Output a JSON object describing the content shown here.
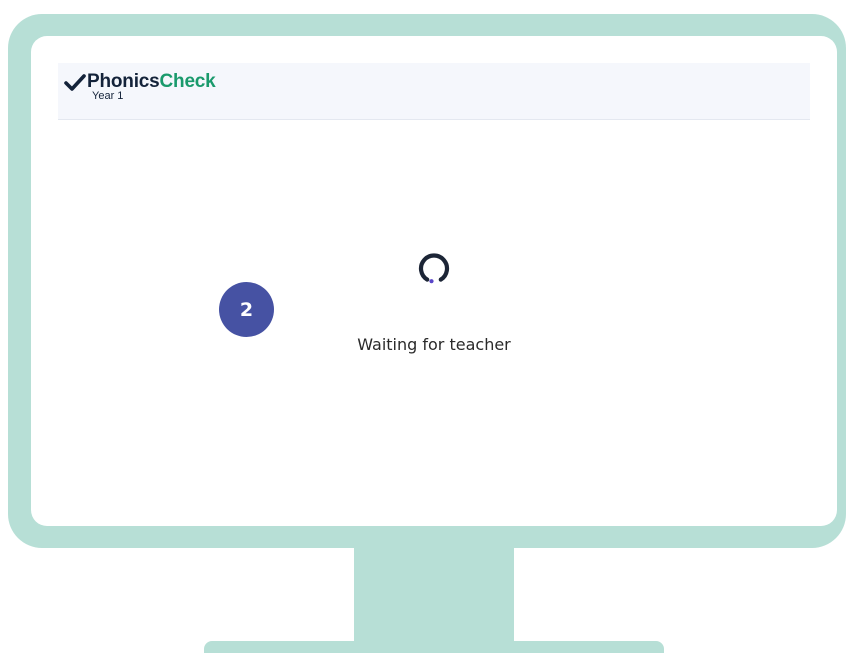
{
  "app": {
    "logo_part1": "Phonics",
    "logo_part2": "Check",
    "logo_subtitle": "Year 1"
  },
  "main": {
    "status_text": "Waiting for teacher",
    "spinner_icon": "loading-spinner-icon"
  },
  "annotation": {
    "step_number": "2"
  },
  "colors": {
    "frame": "#b7dfd6",
    "logo_dark": "#14233a",
    "logo_green": "#1a9a6c",
    "badge": "#4652a3",
    "spinner_dot": "#5a46c8"
  }
}
